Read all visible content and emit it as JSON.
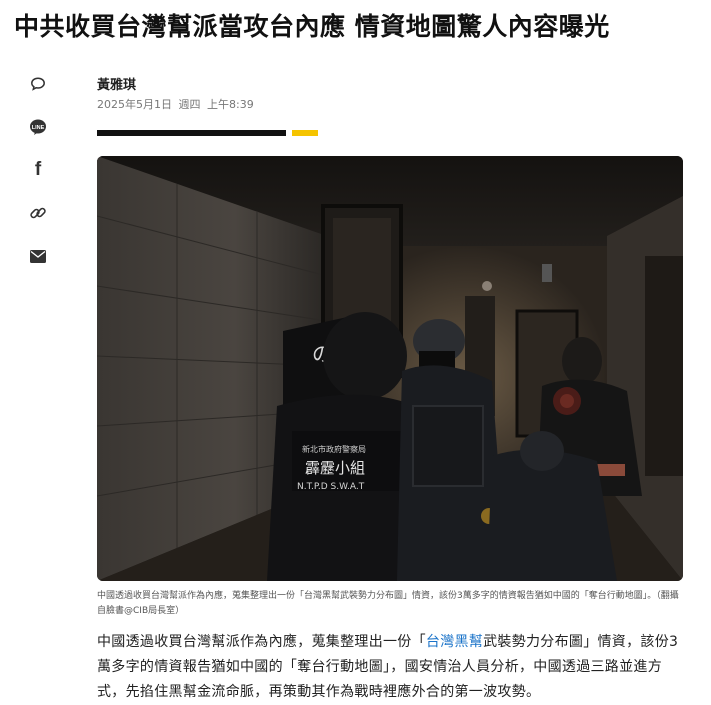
{
  "article": {
    "headline": "中共收買台灣幫派當攻台內應 情資地圖驚人內容曝光",
    "author": "黃雅琪",
    "date": "2025年5月1日",
    "weekday": "週四",
    "time": "上午8:39",
    "caption": "中國透過收買台灣幫派作為內應，蒐集整理出一份「台灣黑幫武裝勢力分布圖」情資，該份3萬多字的情資報告猶如中國的「奪台行動地圖」。（翻攝自臉書@CIB局長室）",
    "body_before": "中國透過收買台灣幫派作為內應，蒐集整理出一份「",
    "body_link": "台灣黑幫",
    "body_after": "武裝勢力分布圖」情資，該份3萬多字的情資報告猶如中國的「奪台行動地圖」，國安情治人員分析，中國透過三路並進方式，先掐住黑幫金流命脈，再策動其作為戰時裡應外合的第一波攻勢。"
  },
  "share": {
    "icons": [
      "comment-icon",
      "line-icon",
      "facebook-icon",
      "link-icon",
      "mail-icon"
    ],
    "line_text": "LINE",
    "facebook_text": "f"
  },
  "photo": {
    "shield_text": "の",
    "vest_text1": "新北市政府警察局",
    "vest_text2": "霹靂小組",
    "vest_text3": "N.T.P.D  S.W.A.T"
  },
  "colors": {
    "accent_yellow": "#f5c400",
    "link_blue": "#1a73c9"
  }
}
